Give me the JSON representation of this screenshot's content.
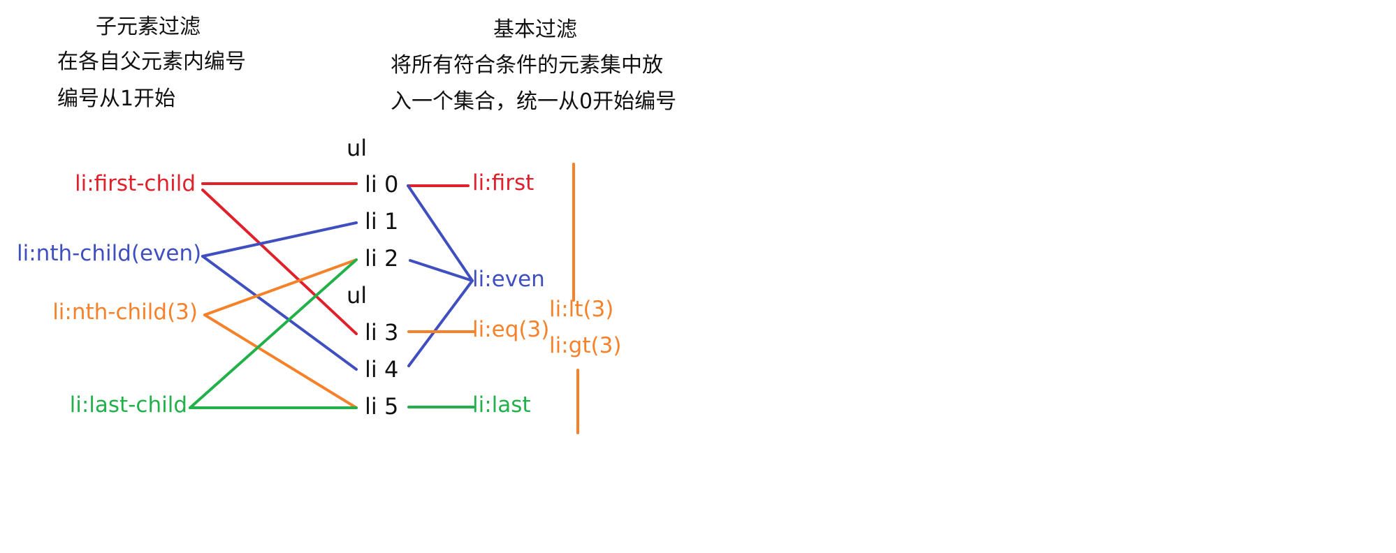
{
  "headings": {
    "left_title": "子元素过滤",
    "left_line1": "在各自父元素内编号",
    "left_line2": "编号从1开始",
    "right_title": "基本过滤",
    "right_line1": "将所有符合条件的元素集中放",
    "right_line2": "入一个集合，统一从0开始编号"
  },
  "tree": {
    "ul_top": "ul",
    "ul_mid": "ul",
    "items": [
      "li 0",
      "li 1",
      "li 2",
      "li 3",
      "li 4",
      "li 5"
    ]
  },
  "child_filters": {
    "first_child": "li:first-child",
    "nth_child_even": "li:nth-child(even)",
    "nth_child_3": "li:nth-child(3)",
    "last_child": "li:last-child"
  },
  "basic_filters": {
    "first": "li:first",
    "even": "li:even",
    "eq3": "li:eq(3)",
    "last": "li:last",
    "lt3": "li:lt(3)",
    "gt3": "li:gt(3)"
  },
  "colors": {
    "red": "#e0202a",
    "blue": "#3f4fc0",
    "orange": "#f5822a",
    "green": "#22b04a"
  },
  "connections": [
    {
      "from": "li:first-child",
      "to": "li 0",
      "color": "red"
    },
    {
      "from": "li:first-child",
      "to": "li 3",
      "color": "red"
    },
    {
      "from": "li:nth-child(even)",
      "to": "li 1",
      "color": "blue"
    },
    {
      "from": "li:nth-child(even)",
      "to": "li 4",
      "color": "blue"
    },
    {
      "from": "li:nth-child(3)",
      "to": "li 2",
      "color": "orange"
    },
    {
      "from": "li:nth-child(3)",
      "to": "li 5",
      "color": "orange"
    },
    {
      "from": "li:last-child",
      "to": "li 2",
      "color": "green"
    },
    {
      "from": "li:last-child",
      "to": "li 5",
      "color": "green"
    },
    {
      "from": "li 0",
      "to": "li:first",
      "color": "red"
    },
    {
      "from": "li 0",
      "to": "li:even",
      "color": "blue"
    },
    {
      "from": "li 2",
      "to": "li:even",
      "color": "blue"
    },
    {
      "from": "li 4",
      "to": "li:even",
      "color": "blue"
    },
    {
      "from": "li 3",
      "to": "li:eq(3)",
      "color": "orange"
    },
    {
      "from": "li 5",
      "to": "li:last",
      "color": "green"
    }
  ]
}
